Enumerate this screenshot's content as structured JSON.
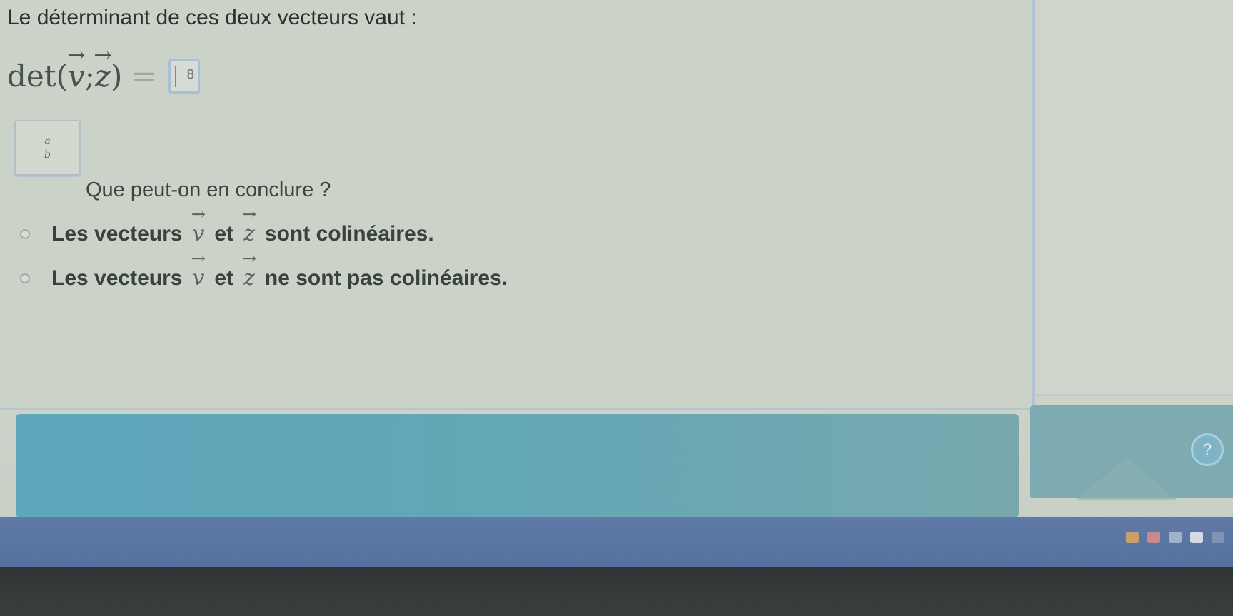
{
  "question": {
    "prompt": "Le déterminant de ces deux vecteurs vaut :",
    "det_label": "det",
    "vec_a": "v",
    "separator": ";",
    "vec_b": "z",
    "equals": "=",
    "answer_hint": "8",
    "fraction_top": "a",
    "fraction_bottom": "b",
    "sub_question": "Que peut-on en conclure ?"
  },
  "options": [
    {
      "prefix": "Les vecteurs",
      "v": "v",
      "mid": "et",
      "z": "z",
      "suffix": "sont colinéaires."
    },
    {
      "prefix": "Les vecteurs",
      "v": "v",
      "mid": "et",
      "z": "z",
      "suffix": "ne sont pas colinéaires."
    }
  ],
  "colors": {
    "validate": "#5ea7bd",
    "taskbar": "#5a74a3",
    "answer_border": "#a7c0d8"
  },
  "icons": [
    "help-icon",
    "tray-icons"
  ]
}
